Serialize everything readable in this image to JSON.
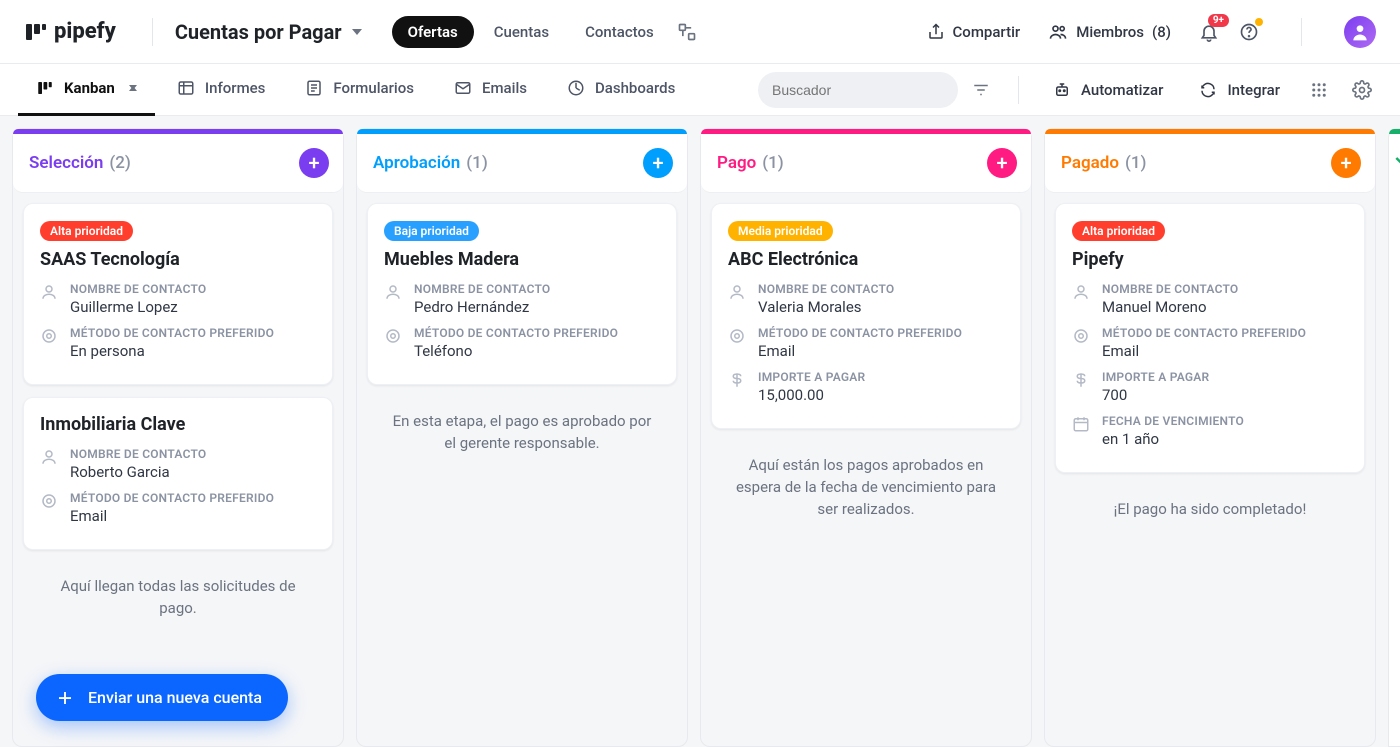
{
  "header": {
    "logo": "pipefy",
    "workspace": "Cuentas por Pagar",
    "nav": {
      "ofertas": "Ofertas",
      "cuentas": "Cuentas",
      "contactos": "Contactos"
    },
    "share": "Compartir",
    "members_label": "Miembros",
    "members_count": "(8)",
    "bell_badge": "9+"
  },
  "toolbar": {
    "kanban": "Kanban",
    "informes": "Informes",
    "formularios": "Formularios",
    "emails": "Emails",
    "dashboards": "Dashboards",
    "search_placeholder": "Buscador",
    "automatizar": "Automatizar",
    "integrar": "Integrar"
  },
  "labels": {
    "contact_name": "NOMBRE DE CONTACTO",
    "contact_method": "MÉTODO DE CONTACTO PREFERIDO",
    "amount": "IMPORTE A PAGAR",
    "due": "FECHA DE VENCIMIENTO"
  },
  "priority": {
    "high": "Alta prioridad",
    "medium": "Media prioridad",
    "low": "Baja prioridad"
  },
  "columns": {
    "seleccion": {
      "title": "Selección",
      "count": "(2)",
      "desc": "Aquí llegan todas las solicitudes de pago."
    },
    "aprobacion": {
      "title": "Aprobación",
      "count": "(1)",
      "desc": "En esta etapa, el pago es aprobado por el gerente responsable."
    },
    "pago": {
      "title": "Pago",
      "count": "(1)",
      "desc": "Aquí están los pagos aprobados en espera de la fecha de vencimiento para ser realizados."
    },
    "pagado": {
      "title": "Pagado",
      "count": "(1)",
      "desc": "¡El pago ha sido completado!"
    }
  },
  "cards": {
    "saas": {
      "title": "SAAS Tecnología",
      "contact": "Guillerme Lopez",
      "method": "En persona"
    },
    "inmob": {
      "title": "Inmobiliaria Clave",
      "contact": "Roberto Garcia",
      "method": "Email"
    },
    "muebles": {
      "title": "Muebles Madera",
      "contact": "Pedro Hernández",
      "method": "Teléfono"
    },
    "abc": {
      "title": "ABC Electrónica",
      "contact": "Valeria Morales",
      "method": "Email",
      "amount": "15,000.00"
    },
    "pipefy": {
      "title": "Pipefy",
      "contact": "Manuel Moreno",
      "method": "Email",
      "amount": "700",
      "due": "en 1 año"
    }
  },
  "fab": "Enviar una nueva cuenta"
}
